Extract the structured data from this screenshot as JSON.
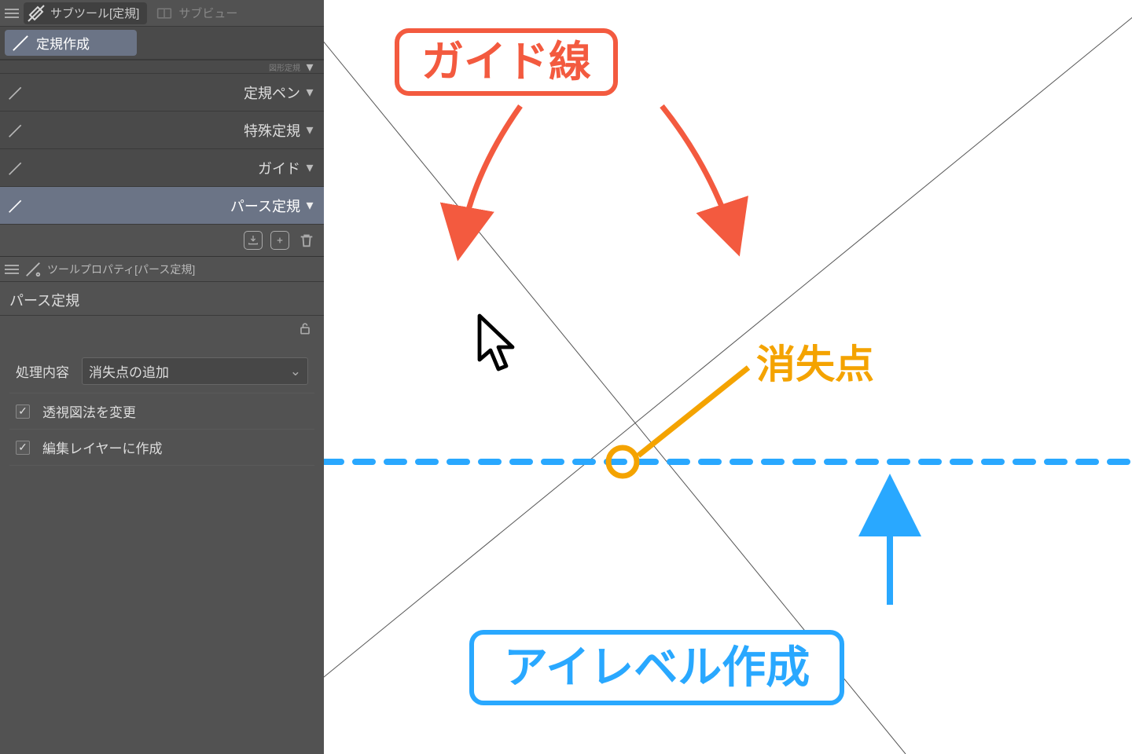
{
  "header": {
    "subtool_tab": "サブツール[定規]",
    "subview_tab": "サブビュー"
  },
  "group_tab": {
    "label": "定規作成"
  },
  "subtools": {
    "items": [
      {
        "label": "図形定規"
      },
      {
        "label": "定規ペン"
      },
      {
        "label": "特殊定規"
      },
      {
        "label": "ガイド"
      },
      {
        "label": "パース定規"
      }
    ]
  },
  "actions": {
    "import": "↓",
    "duplicate": "+",
    "delete": "🗑"
  },
  "property": {
    "header": "ツールプロパティ[パース定規]",
    "title": "パース定規",
    "process_label": "処理内容",
    "process_value": "消失点の追加",
    "checkbox1": "透視図法を変更",
    "checkbox2": "編集レイヤーに作成"
  },
  "annotations": {
    "guide_lines": "ガイド線",
    "vanishing_point": "消失点",
    "eye_level": "アイレベル作成"
  },
  "colors": {
    "red": "#f35a3f",
    "orange": "#f4a300",
    "blue": "#29a8ff"
  }
}
